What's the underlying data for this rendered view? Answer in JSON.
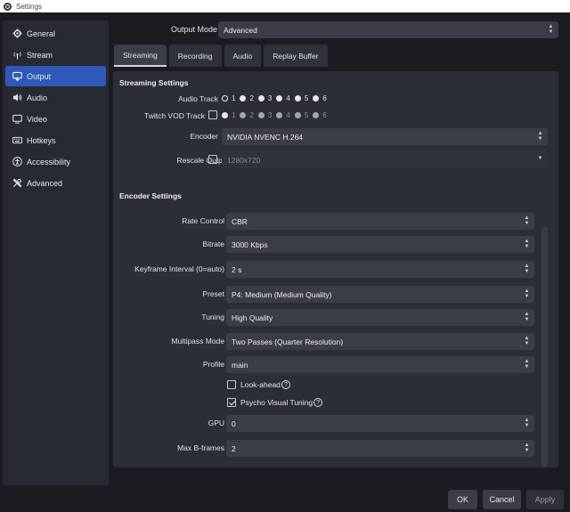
{
  "window": {
    "title": "Settings"
  },
  "sidebar": {
    "items": [
      {
        "label": "General",
        "icon": "gear-icon"
      },
      {
        "label": "Stream",
        "icon": "antenna-icon"
      },
      {
        "label": "Output",
        "icon": "output-icon",
        "active": true
      },
      {
        "label": "Audio",
        "icon": "speaker-icon"
      },
      {
        "label": "Video",
        "icon": "monitor-icon"
      },
      {
        "label": "Hotkeys",
        "icon": "keyboard-icon"
      },
      {
        "label": "Accessibility",
        "icon": "accessibility-icon"
      },
      {
        "label": "Advanced",
        "icon": "tools-icon"
      }
    ]
  },
  "output_mode": {
    "label": "Output Mode",
    "value": "Advanced"
  },
  "tabs": [
    "Streaming",
    "Recording",
    "Audio",
    "Replay Buffer"
  ],
  "streaming": {
    "title": "Streaming Settings",
    "audio_track_label": "Audio Track",
    "twitch_vod_label": "Twitch VOD Track",
    "tracks": [
      "1",
      "2",
      "3",
      "4",
      "5",
      "6"
    ],
    "encoder_label": "Encoder",
    "encoder_value": "NVIDIA NVENC H.264",
    "rescale_label": "Rescale Output",
    "rescale_value": "1280x720"
  },
  "encoder": {
    "title": "Encoder Settings",
    "rate_control_label": "Rate Control",
    "rate_control_value": "CBR",
    "bitrate_label": "Bitrate",
    "bitrate_value": "3000 Kbps",
    "keyframe_label": "Keyframe Interval (0=auto)",
    "keyframe_value": "2 s",
    "preset_label": "Preset",
    "preset_value": "P4: Medium (Medium Quality)",
    "tuning_label": "Tuning",
    "tuning_value": "High Quality",
    "multipass_label": "Multipass Mode",
    "multipass_value": "Two Passes (Quarter Resolution)",
    "profile_label": "Profile",
    "profile_value": "main",
    "lookahead_label": "Look-ahead",
    "psycho_label": "Psycho Visual Tuning",
    "help_glyph": "?",
    "gpu_label": "GPU",
    "gpu_value": "0",
    "bframes_label": "Max B-frames",
    "bframes_value": "2"
  },
  "buttons": {
    "ok": "OK",
    "cancel": "Cancel",
    "apply": "Apply"
  },
  "colors": {
    "accent": "#2f59b8",
    "background": "#1b1c22",
    "panel": "#2b2e37"
  }
}
